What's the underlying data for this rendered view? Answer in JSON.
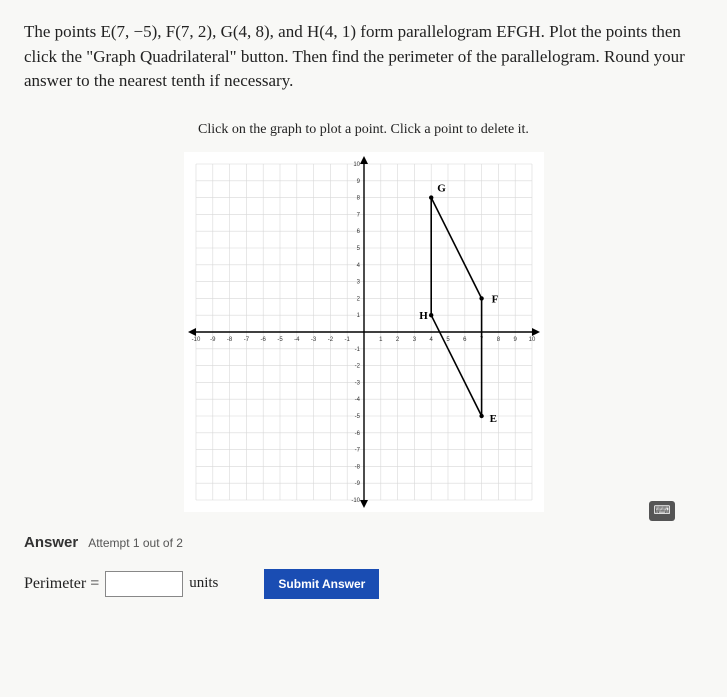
{
  "question": "The points E(7, −5), F(7, 2), G(4, 8), and H(4, 1) form parallelogram EFGH. Plot the points then click the \"Graph Quadrilateral\" button. Then find the perimeter of the parallelogram. Round your answer to the nearest tenth if necessary.",
  "instruction": "Click on the graph to plot a point. Click a point to delete it.",
  "chart_data": {
    "type": "scatter",
    "title": "",
    "xlabel": "",
    "ylabel": "",
    "xlim": [
      -10,
      10
    ],
    "ylim": [
      -10,
      10
    ],
    "xticks": [
      -10,
      -9,
      -8,
      -7,
      -6,
      -5,
      -4,
      -3,
      -2,
      -1,
      1,
      2,
      3,
      4,
      5,
      6,
      7,
      8,
      9,
      10
    ],
    "yticks": [
      -10,
      -9,
      -8,
      -7,
      -6,
      -5,
      -4,
      -3,
      -2,
      -1,
      1,
      2,
      3,
      4,
      5,
      6,
      7,
      8,
      9,
      10
    ],
    "points": [
      {
        "name": "E",
        "x": 7,
        "y": -5
      },
      {
        "name": "F",
        "x": 7,
        "y": 2
      },
      {
        "name": "G",
        "x": 4,
        "y": 8
      },
      {
        "name": "H",
        "x": 4,
        "y": 1
      }
    ],
    "edges": [
      [
        "E",
        "F"
      ],
      [
        "F",
        "G"
      ],
      [
        "G",
        "H"
      ],
      [
        "H",
        "E"
      ]
    ]
  },
  "answer": {
    "label": "Answer",
    "attempt": "Attempt 1 out of 2",
    "perimeter_label": "Perimeter =",
    "perimeter_value": "",
    "units": "units",
    "submit": "Submit Answer"
  }
}
